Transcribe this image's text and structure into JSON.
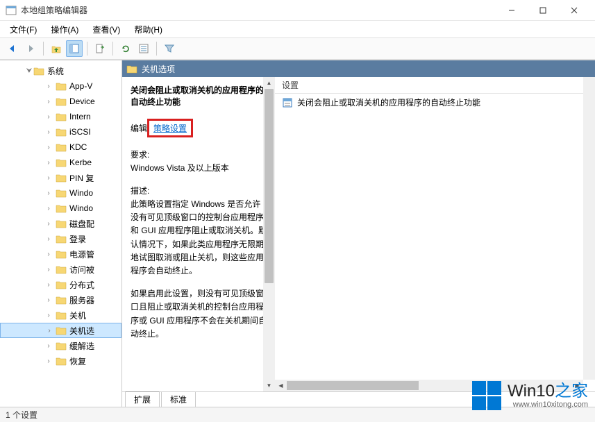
{
  "window": {
    "title": "本地组策略编辑器"
  },
  "menubar": {
    "file": "文件(F)",
    "action": "操作(A)",
    "view": "查看(V)",
    "help": "帮助(H)"
  },
  "tree": {
    "root": "系统",
    "items": [
      "App-V",
      "Device",
      "Intern",
      "iSCSI",
      "KDC",
      "Kerbe",
      "PIN 复",
      "Windo",
      "Windo",
      "磁盘配",
      "登录",
      "电源管",
      "访问被",
      "分布式",
      "服务器",
      "关机",
      "关机选",
      "缓解选",
      "恢复"
    ],
    "selected_index": 16
  },
  "content": {
    "header": "关机选项",
    "policy_title": "关闭会阻止或取消关机的应用程序的自动终止功能",
    "edit_prefix": "编辑",
    "edit_link": "策略设置",
    "req_label": "要求:",
    "req_text": "Windows Vista 及以上版本",
    "desc_label": "描述:",
    "desc_p1": "此策略设置指定 Windows 是否允许没有可见顶级窗口的控制台应用程序和 GUI 应用程序阻止或取消关机。默认情况下，如果此类应用程序无限期地试图取消或阻止关机，则这些应用程序会自动终止。",
    "desc_p2": "如果启用此设置，则没有可见顶级窗口且阻止或取消关机的控制台应用程序或 GUI 应用程序不会在关机期间自动终止。"
  },
  "list": {
    "column": "设置",
    "items": [
      "关闭会阻止或取消关机的应用程序的自动终止功能"
    ]
  },
  "tabs": {
    "extended": "扩展",
    "standard": "标准"
  },
  "statusbar": {
    "text": "1 个设置"
  },
  "watermark": {
    "brand_a": "Win10",
    "brand_b": "之家",
    "url": "www.win10xitong.com"
  }
}
